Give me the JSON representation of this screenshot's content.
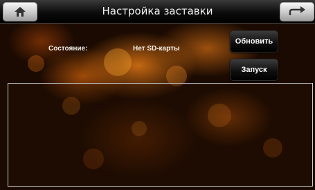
{
  "header": {
    "title": "Настройка заставки",
    "home_icon": "home-icon",
    "back_icon": "back-arrow-icon"
  },
  "status": {
    "label": "Состояние:",
    "value": "Нет SD-карты"
  },
  "buttons": {
    "refresh_label": "Обновить",
    "start_label": "Запуск"
  },
  "colors": {
    "background": "#1a0a02",
    "accent": "#e2781a",
    "button_bg": "#101010"
  }
}
